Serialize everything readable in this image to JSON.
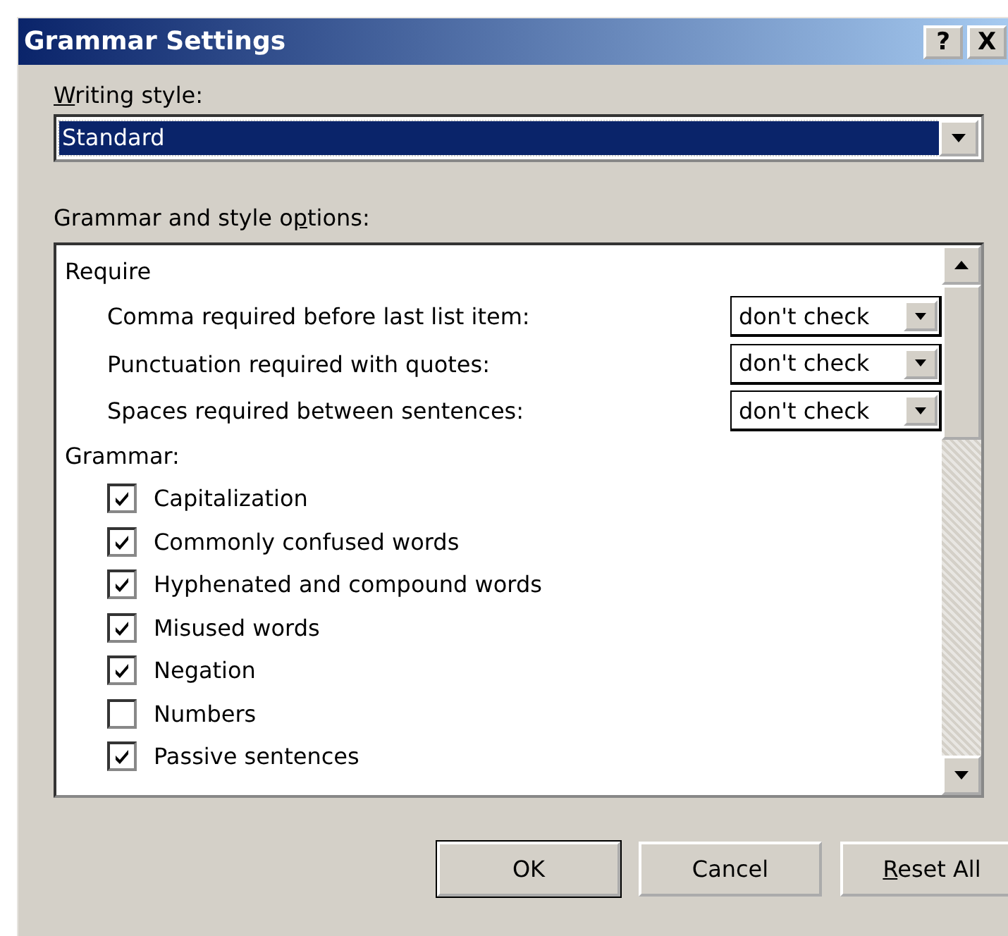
{
  "window": {
    "title": "Grammar Settings",
    "help_button": "?",
    "close_button": "X"
  },
  "writing_style": {
    "label": {
      "access_key": "W",
      "after": "riting style:"
    },
    "value": "Standard",
    "focused": true
  },
  "options": {
    "label": {
      "before": "Grammar and style o",
      "access_key": "p",
      "after": "tions:"
    },
    "groups": [
      {
        "heading": "Require",
        "items": [
          {
            "kind": "select",
            "label": "Comma required before last list item:",
            "value": "don't check"
          },
          {
            "kind": "select",
            "label": "Punctuation required with quotes:",
            "value": "don't check"
          },
          {
            "kind": "select",
            "label": "Spaces required between sentences:",
            "value": "don't check"
          }
        ]
      },
      {
        "heading": "Grammar:",
        "items": [
          {
            "kind": "checkbox",
            "label": "Capitalization",
            "checked": true
          },
          {
            "kind": "checkbox",
            "label": "Commonly confused words",
            "checked": true
          },
          {
            "kind": "checkbox",
            "label": "Hyphenated and compound words",
            "checked": true
          },
          {
            "kind": "checkbox",
            "label": "Misused words",
            "checked": true
          },
          {
            "kind": "checkbox",
            "label": "Negation",
            "checked": true
          },
          {
            "kind": "checkbox",
            "label": "Numbers",
            "checked": false
          },
          {
            "kind": "checkbox",
            "label": "Passive sentences",
            "checked": true
          }
        ]
      }
    ]
  },
  "buttons": [
    {
      "label": "OK",
      "default": true
    },
    {
      "label": "Cancel",
      "default": false
    },
    {
      "label": {
        "access_key": "R",
        "after": "eset All"
      },
      "default": false
    }
  ]
}
